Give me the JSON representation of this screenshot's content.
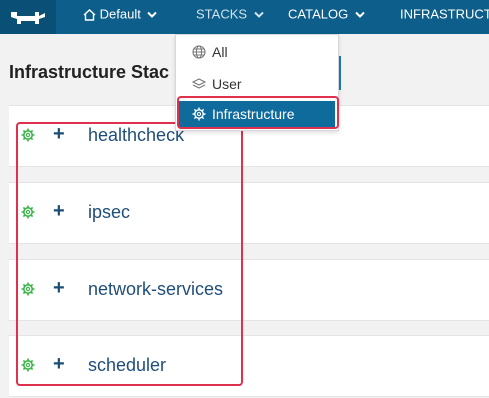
{
  "topbar": {
    "logo_icon": "rancher-cow-icon",
    "environment": {
      "icon": "home-icon",
      "label": "Default"
    },
    "stacks": {
      "label": "STACKS"
    },
    "catalog": {
      "label": "CATALOG"
    },
    "infrastructure": {
      "label": "INFRASTRUCTU"
    }
  },
  "stacks_menu": {
    "items": [
      {
        "label": "All",
        "icon": "globe-icon",
        "selected": false
      },
      {
        "label": "User",
        "icon": "layers-icon",
        "selected": false
      },
      {
        "label": "Infrastructure",
        "icon": "gear-icon",
        "selected": true
      }
    ]
  },
  "page": {
    "title": "Infrastructure Stac"
  },
  "stacks": [
    {
      "name": "healthcheck",
      "expand_symbol": "+"
    },
    {
      "name": "ipsec",
      "expand_symbol": "+"
    },
    {
      "name": "network-services",
      "expand_symbol": "+"
    },
    {
      "name": "scheduler",
      "expand_symbol": "+"
    }
  ],
  "colors": {
    "topbar": "#0d5e8a",
    "accent": "#0f6b9c",
    "status_green": "#3bb54a",
    "highlight": "#e0304d"
  }
}
